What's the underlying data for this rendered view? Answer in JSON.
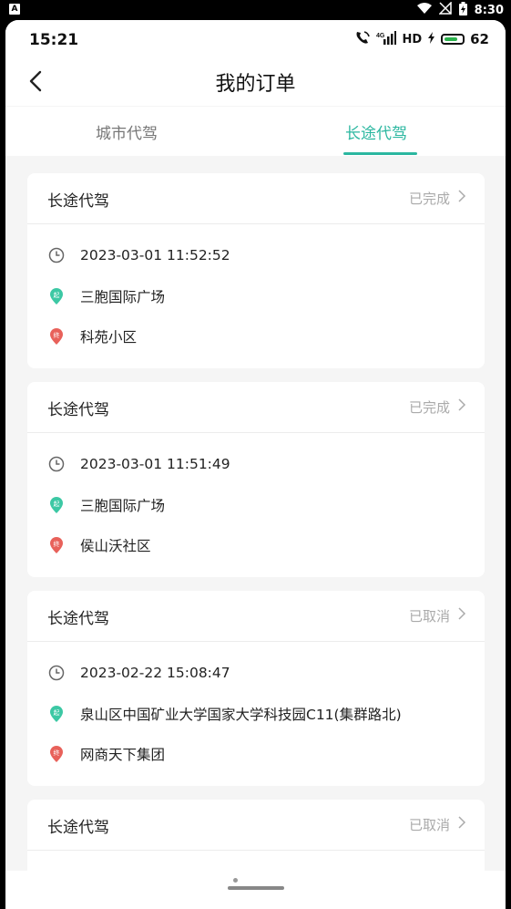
{
  "system_bar": {
    "time": "8:30",
    "left_icon": "A"
  },
  "app_status": {
    "time": "15:21",
    "battery": "62",
    "hd": "HD"
  },
  "nav": {
    "title": "我的订单"
  },
  "tabs": [
    {
      "label": "城市代驾"
    },
    {
      "label": "长途代驾"
    }
  ],
  "active_tab": 1,
  "colors": {
    "accent": "#2bb7a0",
    "start_pin": "#3cc8a4",
    "end_pin": "#e8615a"
  },
  "orders": [
    {
      "type": "长途代驾",
      "status": "已完成",
      "time": "2023-03-01 11:52:52",
      "start": "三胞国际广场",
      "end": "科苑小区"
    },
    {
      "type": "长途代驾",
      "status": "已完成",
      "time": "2023-03-01 11:51:49",
      "start": "三胞国际广场",
      "end": "侯山沃社区"
    },
    {
      "type": "长途代驾",
      "status": "已取消",
      "time": "2023-02-22 15:08:47",
      "start": "泉山区中国矿业大学国家大学科技园C11(集群路北)",
      "end": "网商天下集团"
    },
    {
      "type": "长途代驾",
      "status": "已取消"
    }
  ],
  "pin_labels": {
    "start": "起",
    "end": "终"
  }
}
